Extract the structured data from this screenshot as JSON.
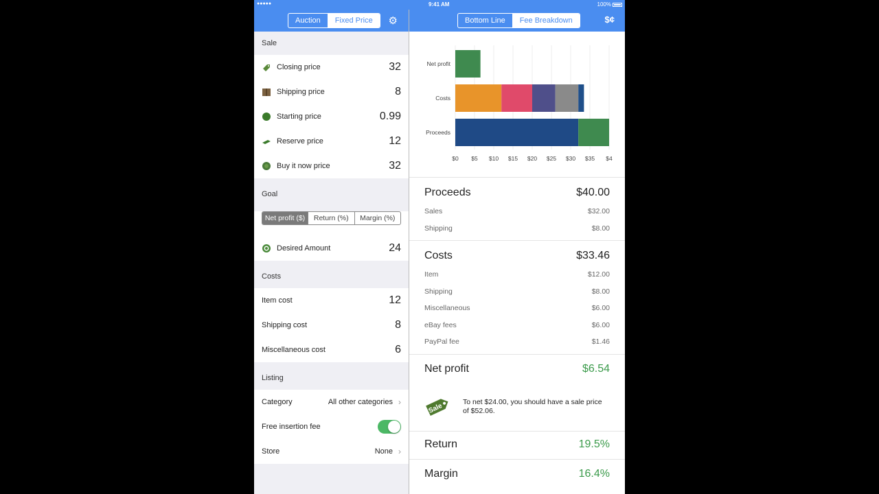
{
  "status": {
    "signal": "●●●●● ",
    "time": "9:41 AM",
    "battery": "100%"
  },
  "left_nav": {
    "tabs": [
      "Auction",
      "Fixed Price"
    ],
    "selected": 1
  },
  "right_nav": {
    "tabs": [
      "Bottom Line",
      "Fee Breakdown"
    ],
    "selected": 1,
    "currency_icon": "$¢"
  },
  "sale": {
    "header": "Sale",
    "rows": [
      {
        "label": "Closing price",
        "value": "32",
        "icon": "tag-icon",
        "color": "#5a8a3a"
      },
      {
        "label": "Shipping price",
        "value": "8",
        "icon": "box-icon",
        "color": "#7a6040"
      },
      {
        "label": "Starting price",
        "value": "0.99",
        "icon": "circle-icon",
        "color": "#3a7a2a"
      },
      {
        "label": "Reserve price",
        "value": "12",
        "icon": "tag-flat-icon",
        "color": "#3a7a2a"
      },
      {
        "label": "Buy it now price",
        "value": "32",
        "icon": "badge-icon",
        "color": "#4a7a3a"
      }
    ]
  },
  "goal": {
    "header": "Goal",
    "options": [
      "Net profit ($)",
      "Return (%)",
      "Margin (%)"
    ],
    "selected": 0,
    "desired_label": "Desired Amount",
    "desired_value": "24"
  },
  "costs": {
    "header": "Costs",
    "rows": [
      {
        "label": "Item cost",
        "value": "12"
      },
      {
        "label": "Shipping cost",
        "value": "8"
      },
      {
        "label": "Miscellaneous cost",
        "value": "6"
      }
    ]
  },
  "listing": {
    "header": "Listing",
    "category_label": "Category",
    "category_value": "All other categories",
    "fee_label": "Free insertion fee",
    "fee_on": true,
    "store_label": "Store",
    "store_value": "None"
  },
  "chart_data": {
    "type": "bar",
    "orientation": "horizontal",
    "stacked": true,
    "categories": [
      "Net profit",
      "Costs",
      "Proceeds"
    ],
    "x_ticks": [
      "$0",
      "$5",
      "$10",
      "$15",
      "$20",
      "$25",
      "$30",
      "$35",
      "$4"
    ],
    "xlim": [
      0,
      40
    ],
    "series": [
      {
        "category": "Net profit",
        "segments": [
          {
            "value": 6.54,
            "color": "#3f8a4f"
          }
        ]
      },
      {
        "category": "Costs",
        "segments": [
          {
            "value": 12,
            "color": "#e8942a"
          },
          {
            "value": 8,
            "color": "#e04a6a"
          },
          {
            "value": 6,
            "color": "#4f4f8a"
          },
          {
            "value": 6,
            "color": "#8a8a8a"
          },
          {
            "value": 1.46,
            "color": "#1f4f8a"
          }
        ]
      },
      {
        "category": "Proceeds",
        "segments": [
          {
            "value": 32,
            "color": "#1f4a86"
          },
          {
            "value": 8,
            "color": "#3f8a4f"
          }
        ]
      }
    ]
  },
  "summary": {
    "proceeds_label": "Proceeds",
    "proceeds_value": "$40.00",
    "sales_label": "Sales",
    "sales_value": "$32.00",
    "shipping_label": "Shipping",
    "shipping_value": "$8.00",
    "costs_label": "Costs",
    "costs_value": "$33.46",
    "item_label": "Item",
    "item_value": "$12.00",
    "cost_shipping_label": "Shipping",
    "cost_shipping_value": "$8.00",
    "misc_label": "Miscellaneous",
    "misc_value": "$6.00",
    "ebay_label": "eBay fees",
    "ebay_value": "$6.00",
    "paypal_label": "PayPal fee",
    "paypal_value": "$1.46",
    "net_label": "Net profit",
    "net_value": "$6.54",
    "tip_line1": "To net $24.00, you should have a sale price",
    "tip_line2": "of $52.06.",
    "tip_icon_text": "Sale",
    "return_label": "Return",
    "return_value": "19.5%",
    "margin_label": "Margin",
    "margin_value": "16.4%"
  }
}
